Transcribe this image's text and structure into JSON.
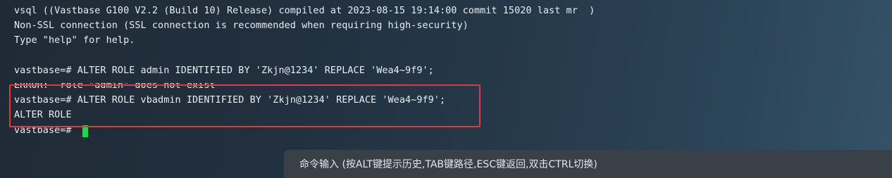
{
  "terminal": {
    "lines": [
      "vsql ((Vastbase G100 V2.2 (Build 10) Release) compiled at 2023-08-15 19:14:00 commit 15020 last mr  )",
      "Non-SSL connection (SSL connection is recommended when requiring high-security)",
      "Type \"help\" for help.",
      "",
      "vastbase=# ALTER ROLE admin IDENTIFIED BY 'Zkjn@1234' REPLACE 'Wea4~9f9';",
      "ERROR:  role \"admin\" does not exist",
      "vastbase=# ALTER ROLE vbadmin IDENTIFIED BY 'Zkjn@1234' REPLACE 'Wea4~9f9';",
      "ALTER ROLE",
      "vastbase=# "
    ],
    "cursor_color": "#19d84a"
  },
  "highlight": {
    "color": "#e03a3a"
  },
  "hint_bar": {
    "text": "命令输入 (按ALT键提示历史,TAB键路径,ESC键返回,双击CTRL切换)"
  }
}
